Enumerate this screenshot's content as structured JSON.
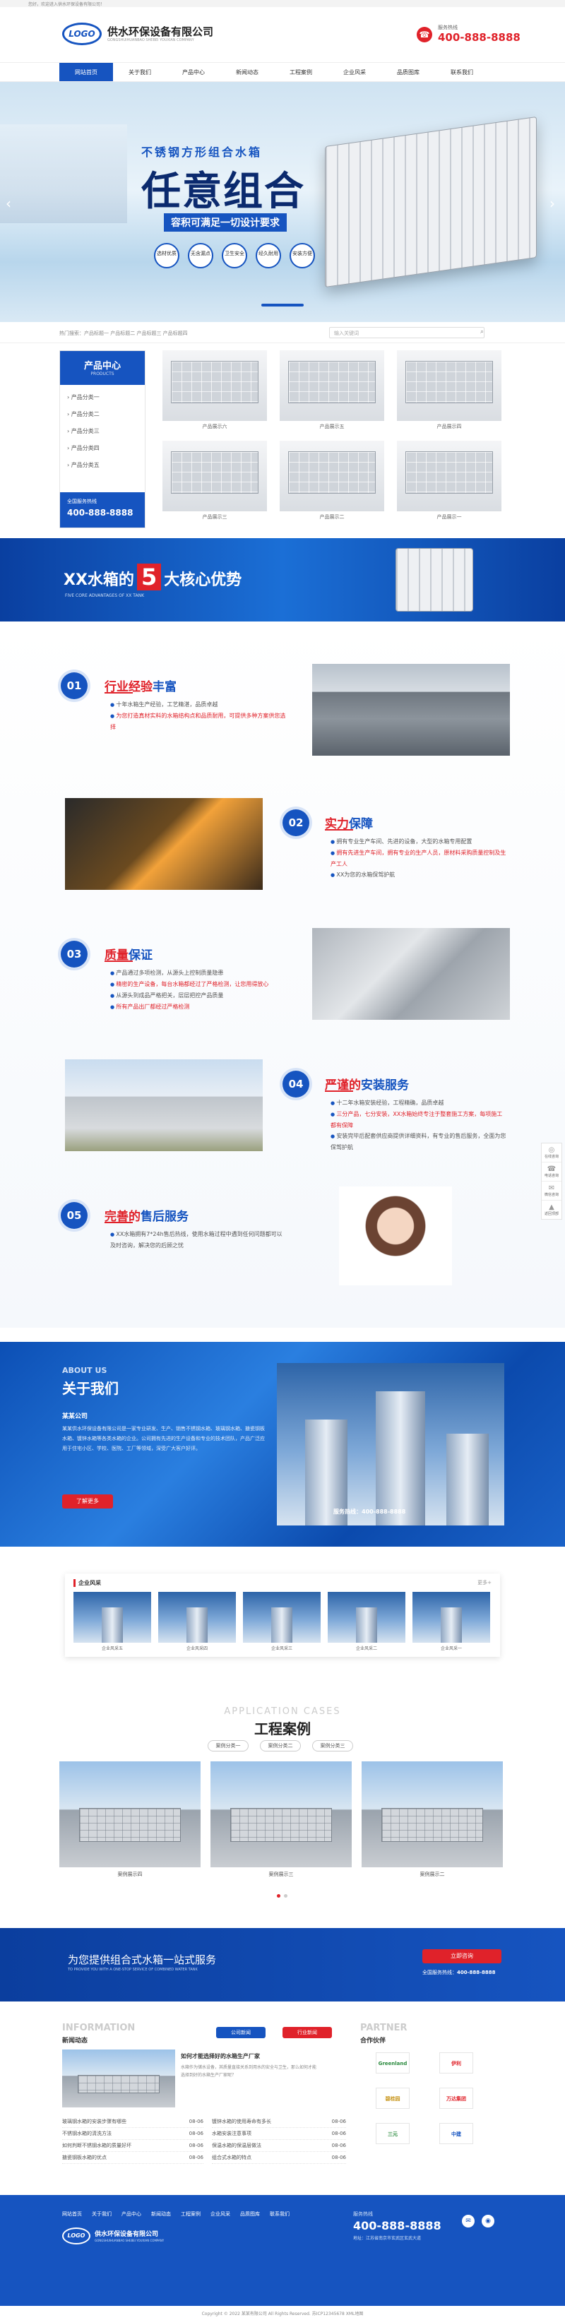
{
  "topbar": {
    "text": "您好，欢迎进入供水环保设备有限公司！"
  },
  "header": {
    "logo": "LOGO",
    "company": "供水环保设备有限公司",
    "company_en": "GONGSHUIHUANBAO SHEBEI YOUXIAN COMPANY",
    "hotline_label": "服务热线",
    "phone": "400-888-8888"
  },
  "nav": [
    "网站首页",
    "关于我们",
    "产品中心",
    "新闻动态",
    "工程案例",
    "企业风采",
    "品质图库",
    "联系我们"
  ],
  "banner": {
    "line1": "不锈钢方形组合水箱",
    "big": "任意组合",
    "sub": "容积可满足一切设计要求",
    "features": [
      "选材优质",
      "无含漏点",
      "卫生安全",
      "经久耐用",
      "安装方便"
    ]
  },
  "breadcrumb": {
    "text": "热门搜索：产品标题一  产品标题二  产品标题三  产品标题四",
    "search_placeholder": "输入关键词"
  },
  "product_center": {
    "title": "产品中心",
    "title_en": "PRODUCTS",
    "categories": [
      "产品分类一",
      "产品分类二",
      "产品分类三",
      "产品分类四",
      "产品分类五"
    ],
    "phone_label": "全国服务热线",
    "phone": "400-888-8888"
  },
  "products": [
    "产品展示六",
    "产品展示五",
    "产品展示四",
    "产品展示三",
    "产品展示二",
    "产品展示一"
  ],
  "adv_banner": {
    "pre": "XX水箱的",
    "num": "5",
    "post": "大核心优势",
    "en": "FIVE CORE ADVANTAGES OF XX TANK"
  },
  "advantages": [
    {
      "num": "01",
      "t1": "行业经验",
      "t2": "丰富",
      "items": [
        "十年水箱生产经验，工艺精湛，品质卓越",
        "为您打造真材实料的水箱结构点和品质耐用，可提供多种方案供您选择"
      ],
      "hl": [
        1
      ]
    },
    {
      "num": "02",
      "t1": "实力",
      "t2": "保障",
      "items": [
        "拥有专业生产车间、先进的设备，大型的水箱专用配置",
        "拥有先进生产车间，拥有专业的生产人员，原材料采购质量控制及生产工人",
        "XX为您的水箱保驾护航"
      ],
      "hl": [
        1
      ]
    },
    {
      "num": "03",
      "t1": "质量",
      "t2": "保证",
      "items": [
        "产品通过多项检测，从源头上控制质量隐患",
        "精密的生产设备，每台水箱都经过了严格检测，让您用得放心",
        "从源头到成品严格把关，层层把控产品质量",
        "所有产品出厂都经过严格检测"
      ],
      "hl": [
        1,
        3
      ]
    },
    {
      "num": "04",
      "t1": "严谨的",
      "t2": "安装服务",
      "items": [
        "十二年水箱安装经验，工程精确，品质卓越",
        "三分产品，七分安装，XX水箱始终专注于整套施工方案，每项施工都有保障",
        "安装完毕后配套供应商提供详细资料，有专业的售后服务，全面为您保驾护航"
      ],
      "hl": [
        1
      ]
    },
    {
      "num": "05",
      "t1": "完善的",
      "t2": "售后服务",
      "items": [
        "XX水箱拥有7*24h售后热线，使用水箱过程中遇到任何问题都可以及时咨询，解决您的后顾之忧"
      ],
      "hl": []
    }
  ],
  "about": {
    "en": "ABOUT US",
    "title": "关于我们",
    "company": "某某公司",
    "text": "某某供水环保设备有限公司是一家专业研发、生产、销售不锈钢水箱、玻璃钢水箱、搪瓷钢板水箱、镀锌水箱等各类水箱的企业。公司拥有先进的生产设备和专业的技术团队，产品广泛应用于住宅小区、学校、医院、工厂等领域，深受广大客户好评。",
    "more": "了解更多",
    "hotline": "服务热线：400-888-8888"
  },
  "style_section": {
    "title": "企业风采",
    "more": "更多+",
    "items": [
      "企业风采五",
      "企业风采四",
      "企业风采三",
      "企业风采二",
      "企业风采一"
    ]
  },
  "cases": {
    "en": "APPLICATION CASES",
    "title": "工程案例",
    "tabs": [
      "案例分类一",
      "案例分类二",
      "案例分类三"
    ],
    "items": [
      "案例展示四",
      "案例展示三",
      "案例展示二"
    ]
  },
  "cta": {
    "text": "为您提供组合式水箱一站式服务",
    "en": "TO PROVIDE YOU WITH A ONE-STOP SERVICE OF COMBINED WATER TANK",
    "btn": "立即咨询",
    "phone_label": "全国服务热线：",
    "phone": "400-888-8888"
  },
  "news": {
    "en": "INFORMATION",
    "title": "新闻动态",
    "tabs": [
      "公司新闻",
      "行业新闻"
    ],
    "feature_title": "如何才能选择好的水箱生产厂家",
    "feature_text": "水箱作为储水设备，其质量直接关系到用水的安全与卫生，那么如何才能选择到好的水箱生产厂家呢？",
    "left": [
      {
        "t": "玻璃钢水箱的安装步骤有哪些",
        "d": "08-06"
      },
      {
        "t": "不锈钢水箱的清洗方法",
        "d": "08-06"
      },
      {
        "t": "如何判断不锈钢水箱的质量好坏",
        "d": "08-06"
      },
      {
        "t": "搪瓷钢板水箱的优点",
        "d": "08-06"
      }
    ],
    "right": [
      {
        "t": "镀锌水箱的使用寿命有多长",
        "d": "08-06"
      },
      {
        "t": "水箱安装注意事项",
        "d": "08-06"
      },
      {
        "t": "保温水箱的保温层做法",
        "d": "08-06"
      },
      {
        "t": "组合式水箱的特点",
        "d": "08-06"
      }
    ]
  },
  "partner": {
    "en": "PARTNER",
    "title": "合作伙伴",
    "items": [
      "Greenland",
      "伊利",
      "碧桂园",
      "万达集团",
      "三元",
      "中建"
    ]
  },
  "footer": {
    "nav": [
      "网站首页",
      "关于我们",
      "产品中心",
      "新闻动态",
      "工程案例",
      "企业风采",
      "品质图库",
      "联系我们"
    ],
    "logo": "LOGO",
    "company": "供水环保设备有限公司",
    "company_en": "GONGSHUIHUANBAO SHEBEI YOUXIAN COMPANY",
    "phone_label": "服务热线",
    "phone": "400-888-8888",
    "addr": "地址：江苏省南京市玄武区玄武大道",
    "copyright": "Copyright © 2022 某某有限公司 All Rights Reserved. 苏ICP12345678 XML地图"
  },
  "float": [
    "在线咨询",
    "电话咨询",
    "微信咨询",
    "返回顶部"
  ]
}
